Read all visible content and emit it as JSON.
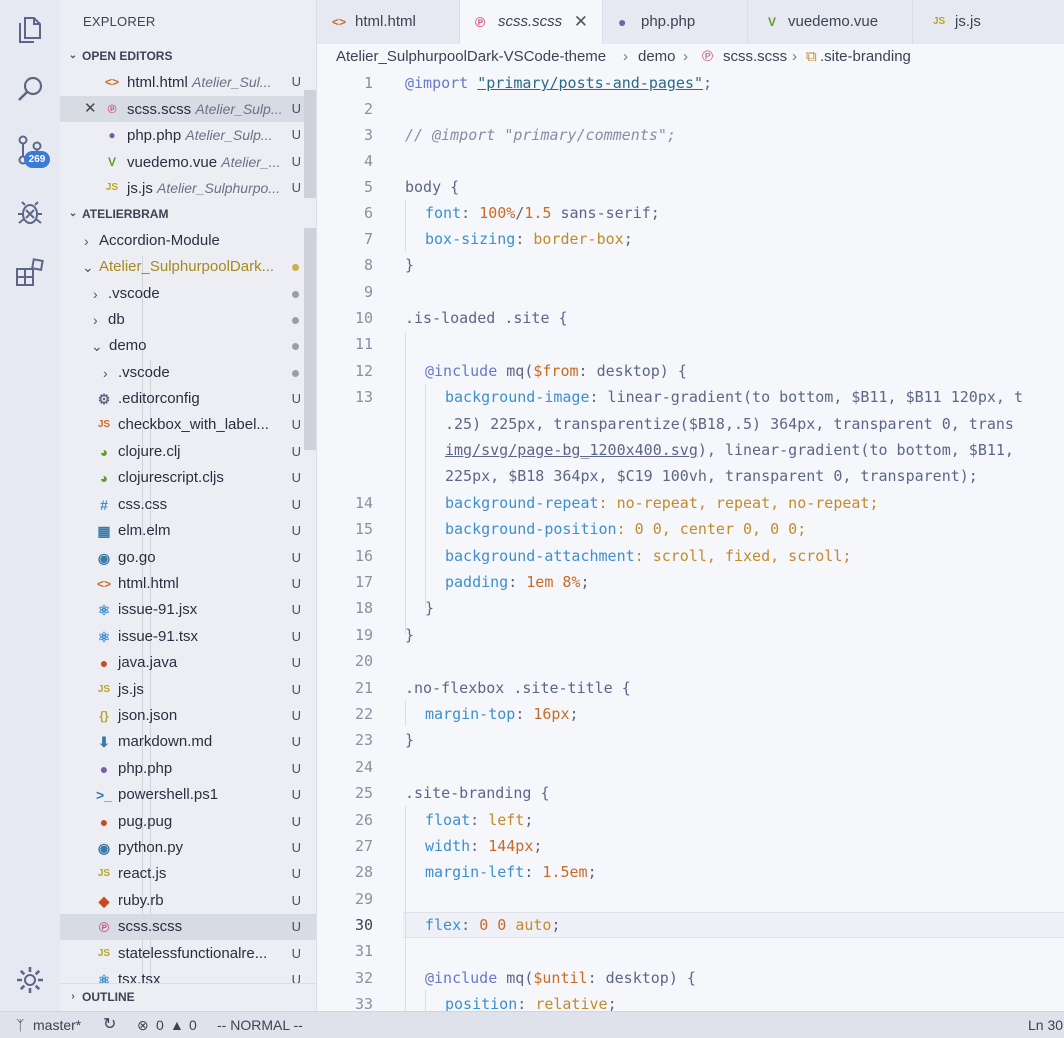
{
  "activity_bar": {
    "scm_badge": "269",
    "icons": [
      "files-icon",
      "search-icon",
      "source-control-icon",
      "debug-icon",
      "extensions-icon",
      "settings-gear-icon"
    ]
  },
  "sidebar": {
    "title": "EXPLORER",
    "open_editors": {
      "label": "OPEN EDITORS",
      "items": [
        {
          "name": "html.html",
          "folder": "Atelier_Sul...",
          "status": "U"
        },
        {
          "name": "scss.scss",
          "folder": "Atelier_Sulp...",
          "status": "U"
        },
        {
          "name": "php.php",
          "folder": "Atelier_Sulp...",
          "status": "U"
        },
        {
          "name": "vuedemo.vue",
          "folder": "Atelier_...",
          "status": "U"
        },
        {
          "name": "js.js",
          "folder": "Atelier_Sulphurpo...",
          "status": "U"
        }
      ]
    },
    "workspace": {
      "label": "ATELIERBRAM",
      "folders": [
        {
          "name": "Accordion-Module"
        },
        {
          "name": "Atelier_SulphurpoolDark..."
        },
        {
          "name": ".vscode"
        },
        {
          "name": "db"
        },
        {
          "name": "demo"
        },
        {
          "name": ".vscode"
        }
      ],
      "files": [
        {
          "name": ".editorconfig",
          "status": "U"
        },
        {
          "name": "checkbox_with_label...",
          "status": "U"
        },
        {
          "name": "clojure.clj",
          "status": "U"
        },
        {
          "name": "clojurescript.cljs",
          "status": "U"
        },
        {
          "name": "css.css",
          "status": "U"
        },
        {
          "name": "elm.elm",
          "status": "U"
        },
        {
          "name": "go.go",
          "status": "U"
        },
        {
          "name": "html.html",
          "status": "U"
        },
        {
          "name": "issue-91.jsx",
          "status": "U"
        },
        {
          "name": "issue-91.tsx",
          "status": "U"
        },
        {
          "name": "java.java",
          "status": "U"
        },
        {
          "name": "js.js",
          "status": "U"
        },
        {
          "name": "json.json",
          "status": "U"
        },
        {
          "name": "markdown.md",
          "status": "U"
        },
        {
          "name": "php.php",
          "status": "U"
        },
        {
          "name": "powershell.ps1",
          "status": "U"
        },
        {
          "name": "pug.pug",
          "status": "U"
        },
        {
          "name": "python.py",
          "status": "U"
        },
        {
          "name": "react.js",
          "status": "U"
        },
        {
          "name": "ruby.rb",
          "status": "U"
        },
        {
          "name": "scss.scss",
          "status": "U"
        },
        {
          "name": "statelessfunctionalre...",
          "status": "U"
        },
        {
          "name": "tsx.tsx",
          "status": "U"
        }
      ]
    },
    "outline_label": "OUTLINE"
  },
  "tabs": [
    {
      "label": "html.html"
    },
    {
      "label": "scss.scss"
    },
    {
      "label": "php.php"
    },
    {
      "label": "vuedemo.vue"
    },
    {
      "label": "js.js"
    }
  ],
  "breadcrumb": {
    "root": "Atelier_SulphurpoolDark-VSCode-theme",
    "folder": "demo",
    "file": "scss.scss",
    "symbol": ".site-branding"
  },
  "editor": {
    "line_numbers": [
      "1",
      "2",
      "3",
      "4",
      "5",
      "6",
      "7",
      "8",
      "9",
      "10",
      "11",
      "12",
      "13",
      "14",
      "15",
      "16",
      "17",
      "18",
      "19",
      "20",
      "21",
      "22",
      "23",
      "24",
      "25",
      "26",
      "27",
      "28",
      "29",
      "30",
      "31",
      "32",
      "33"
    ],
    "code": {
      "l1_kw": "@import",
      "l1_str": "\"primary/posts-and-pages\"",
      "l1_end": ";",
      "l3": "// @import \"primary/comments\";",
      "l5_sel": "body",
      "l5_end": " {",
      "l6_prop": "font",
      "l6_a": ": ",
      "l6_n1": "100%",
      "l6_b": "/",
      "l6_n2": "1.5",
      "l6_c": " sans-serif;",
      "l7_prop": "box-sizing",
      "l7_a": ": ",
      "l7_val": "border-box",
      "l7_end": ";",
      "l8": "}",
      "l10_cls": ".is-loaded",
      "l10_b": " ",
      "l10_cls2": ".site",
      "l10_end": " {",
      "l12_kw": "@include",
      "l12_a": " mq(",
      "l12_var": "$from",
      "l12_b": ": desktop) {",
      "l13a_prop": "background-image",
      "l13a_rest": ": linear-gradient(to bottom, $B11, $B11 120px, t",
      "l13b": ".25) 225px, transparentize($B18,.5) 364px, transparent 0, trans",
      "l13c_link": "img/svg/page-bg_1200x400.svg",
      "l13c_rest": "), linear-gradient(to bottom, $B11,",
      "l13d": "225px, $B18 364px, $C19 100vh, transparent 0, transparent);",
      "l14_prop": "background-repeat",
      "l14_rest": ": no-repeat, repeat, no-repeat;",
      "l15_prop": "background-position",
      "l15_rest": ": 0 0, center 0, 0 0;",
      "l16_prop": "background-attachment",
      "l16_rest": ": scroll, fixed, scroll;",
      "l17_prop": "padding",
      "l17_a": ": ",
      "l17_n1": "1em",
      "l17_b": " ",
      "l17_n2": "8%",
      "l17_end": ";",
      "l18": "}",
      "l19": "}",
      "l21_cls": ".no-flexbox",
      "l21_b": " ",
      "l21_cls2": ".site-title",
      "l21_end": " {",
      "l22_prop": "margin-top",
      "l22_a": ": ",
      "l22_n": "16px",
      "l22_end": ";",
      "l23": "}",
      "l25_cls": ".site-branding",
      "l25_end": " {",
      "l26_prop": "float",
      "l26_a": ": ",
      "l26_val": "left",
      "l26_end": ";",
      "l27_prop": "width",
      "l27_a": ": ",
      "l27_n": "144px",
      "l27_end": ";",
      "l28_prop": "margin-left",
      "l28_a": ": ",
      "l28_n": "1.5em",
      "l28_end": ";",
      "l30_prop": "flex",
      "l30_a": ": ",
      "l30_n1": "0",
      "l30_b": " ",
      "l30_n2": "0",
      "l30_c": " ",
      "l30_val": "auto",
      "l30_end": ";",
      "l32_kw": "@include",
      "l32_a": " mq(",
      "l32_var": "$until",
      "l32_b": ": desktop) {",
      "l33_prop": "position",
      "l33_a": ": ",
      "l33_val": "relative",
      "l33_end": ";"
    }
  },
  "status_bar": {
    "branch": "master*",
    "errors": "0",
    "warnings": "0",
    "mode": "-- NORMAL --",
    "position": "Ln 30,"
  },
  "colors": {
    "accent": "#3a7bd5",
    "keyword": "#6679cc",
    "property": "#3d8fd1",
    "number": "#c76b29",
    "value": "#c08b30"
  }
}
